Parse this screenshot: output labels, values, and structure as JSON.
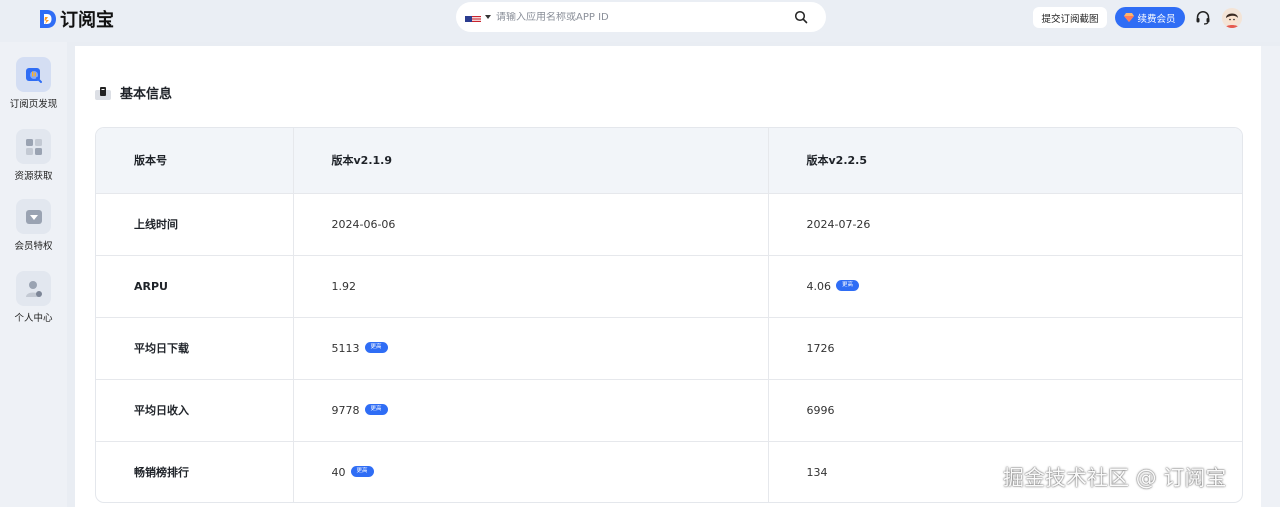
{
  "header": {
    "logo_text": "订阅宝",
    "search": {
      "placeholder": "请输入应用名称或APP ID",
      "country_icon": "us-flag-icon"
    },
    "submit_button": "提交订阅截图",
    "vip_button": "续费会员"
  },
  "sidebar": {
    "items": [
      {
        "label": "订阅页发现",
        "icon": "discover-icon",
        "active": true
      },
      {
        "label": "资源获取",
        "icon": "resource-icon",
        "active": false
      },
      {
        "label": "会员特权",
        "icon": "vip-privilege-icon",
        "active": false
      },
      {
        "label": "个人中心",
        "icon": "user-center-icon",
        "active": false
      }
    ]
  },
  "main": {
    "section_title": "基本信息",
    "table": {
      "headers": [
        "版本号",
        "版本v2.1.9",
        "版本v2.2.5"
      ],
      "rows": [
        {
          "label": "上线时间",
          "a": "2024-06-06",
          "a_badge": "",
          "b": "2024-07-26",
          "b_badge": ""
        },
        {
          "label": "ARPU",
          "a": "1.92",
          "a_badge": "",
          "b": "4.06",
          "b_badge": "更高"
        },
        {
          "label": "平均日下载",
          "a": "5113",
          "a_badge": "更高",
          "b": "1726",
          "b_badge": ""
        },
        {
          "label": "平均日收入",
          "a": "9778",
          "a_badge": "更高",
          "b": "6996",
          "b_badge": ""
        },
        {
          "label": "畅销榜排行",
          "a": "40",
          "a_badge": "更高",
          "b": "134",
          "b_badge": ""
        }
      ]
    }
  },
  "watermark": "掘金技术社区 @ 订阅宝",
  "colors": {
    "accent": "#2f6df5",
    "background": "#e9edf3"
  }
}
